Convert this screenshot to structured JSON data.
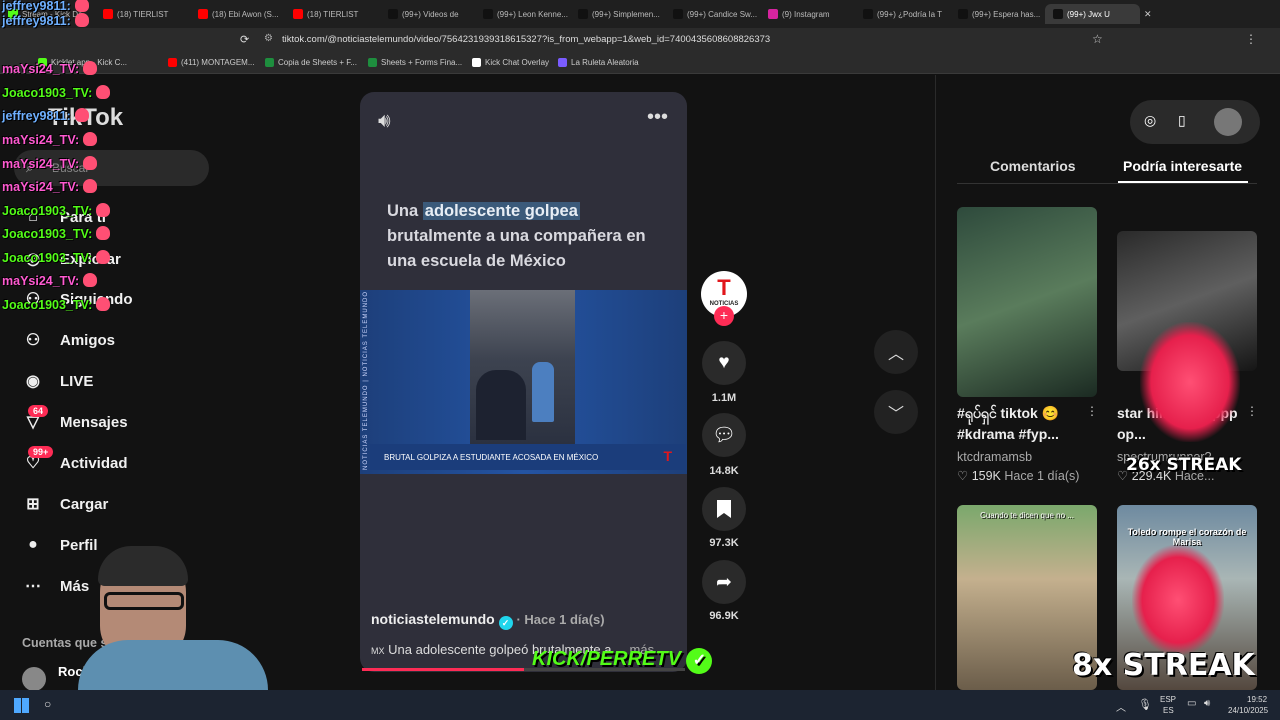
{
  "browser": {
    "tabs": [
      {
        "label": "Stream - Kick Da",
        "color": "#53fc18"
      },
      {
        "label": "(18) TIERLIST",
        "color": "#ff0000"
      },
      {
        "label": "(18) Ebi Awon (S...",
        "color": "#ff0000"
      },
      {
        "label": "(18) TIERLIST",
        "color": "#ff0000"
      },
      {
        "label": "(99+) Videos de",
        "color": "#111111"
      },
      {
        "label": "(99+) Leon Kenne...",
        "color": "#111111"
      },
      {
        "label": "(99+) Simplemen...",
        "color": "#111111"
      },
      {
        "label": "(99+) Candice Sw...",
        "color": "#111111"
      },
      {
        "label": "(9) Instagram",
        "color": "#d6249f"
      },
      {
        "label": "(99+) ¿Podría la T",
        "color": "#111111"
      },
      {
        "label": "(99+) Espera has...",
        "color": "#111111"
      },
      {
        "label": "(99+) Jwx U",
        "color": "#111111"
      }
    ],
    "url": "tiktok.com/@noticiastelemundo/video/7564231939318615327?is_from_webapp=1&web_id=7400435608608826373",
    "bookmarks": [
      {
        "label": "Kicklet.app - Kick C...",
        "color": "#53fc18"
      },
      {
        "label": "(411) MONTAGEM...",
        "color": "#ff0000"
      },
      {
        "label": "Copia de Sheets + F...",
        "color": "#1e8e3e"
      },
      {
        "label": "Sheets + Forms Fina...",
        "color": "#1e8e3e"
      },
      {
        "label": "Kick Chat Overlay",
        "color": "#ffffff"
      },
      {
        "label": "La Ruleta Aleatoria",
        "color": "#7a5cff"
      }
    ]
  },
  "sidebar": {
    "logo": "TikTok",
    "search_placeholder": "Buscar",
    "items": [
      {
        "label": "Para ti",
        "icon": "home-icon"
      },
      {
        "label": "Explorar",
        "icon": "compass-icon"
      },
      {
        "label": "Siguiendo",
        "icon": "following-icon"
      },
      {
        "label": "Amigos",
        "icon": "friends-icon"
      },
      {
        "label": "LIVE",
        "icon": "live-icon"
      },
      {
        "label": "Mensajes",
        "icon": "messages-icon",
        "badge": "64"
      },
      {
        "label": "Actividad",
        "icon": "activity-icon",
        "badge": "99+"
      },
      {
        "label": "Cargar",
        "icon": "upload-icon"
      },
      {
        "label": "Perfil",
        "icon": "profile-icon"
      },
      {
        "label": "Más",
        "icon": "more-icon"
      }
    ],
    "following_header": "Cuentas que sigues",
    "following_first": "Rock"
  },
  "video": {
    "title_pre": "Una ",
    "title_highlight": "adolescente golpea",
    "title_post": " brutalmente a una compañera en una escuela de México",
    "lower_third": "BRUTAL GOLPIZA A ESTUDIANTE ACOSADA EN MÉXICO",
    "side_brand": "NOTICIAS TELEMUNDO | NOTICIAS TELEMUNDO",
    "channel_logo": "NOTICIAS",
    "author": "noticiastelemundo",
    "time_ago": "· Hace 1 día(s)",
    "desc_flag": "MX",
    "description": "Una adolescente golpeó brutalmente a ...",
    "more": "más"
  },
  "actions": {
    "likes": "1.1M",
    "comments": "14.8K",
    "saves": "97.3K",
    "shares": "96.9K"
  },
  "right_panel": {
    "tabs": [
      "Comentarios",
      "Podría interesarte"
    ],
    "recommendations": [
      {
        "title": "#ရုပ်ရှင် tiktok 😊 #kdrama #fyp...",
        "author": "ktcdramamsb",
        "likes": "159K",
        "time": "Hace 1 día(s)"
      },
      {
        "title": "star hill #fyp pppp op...",
        "author": "spectrumrunner?",
        "likes": "229.4K",
        "time": "Hace..."
      },
      {
        "title": "",
        "overlay": "Cuando te dicen que no ...",
        "author": "",
        "likes": "",
        "time": ""
      },
      {
        "title": "",
        "overlay": "Toledo rompe el corazón de Marisa",
        "author": "",
        "likes": "",
        "time": ""
      }
    ]
  },
  "overlays": {
    "chat": [
      {
        "user": "jeffrey9811:",
        "color": "#6fb0ff"
      },
      {
        "user": "jeffrey9811:",
        "color": "#6fb0ff"
      },
      {
        "user": "maYsi24_TV:",
        "color": "#ff5ad1"
      },
      {
        "user": "Joaco1903_TV:",
        "color": "#53fc18"
      },
      {
        "user": "jeffrey9811:",
        "color": "#6fb0ff"
      },
      {
        "user": "maYsi24_TV:",
        "color": "#ff5ad1"
      },
      {
        "user": "maYsi24_TV:",
        "color": "#ff5ad1"
      },
      {
        "user": "maYsi24_TV:",
        "color": "#ff5ad1"
      },
      {
        "user": "Joaco1903_TV:",
        "color": "#53fc18"
      },
      {
        "user": "Joaco1903_TV:",
        "color": "#53fc18"
      },
      {
        "user": "Joaco1903_TV:",
        "color": "#53fc18"
      },
      {
        "user": "maYsi24_TV:",
        "color": "#ff5ad1"
      },
      {
        "user": "Joaco1903_TV:",
        "color": "#53fc18"
      }
    ],
    "streak_26": "26x STREAK",
    "streak_8": "8x STREAK",
    "kick_brand": "KICK/PERRETV"
  },
  "taskbar": {
    "lang": "ESP",
    "lang_sub": "ES",
    "time": "19:52",
    "date": "24/10/2025"
  }
}
